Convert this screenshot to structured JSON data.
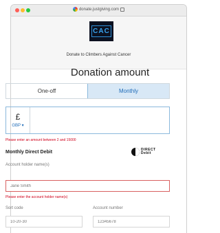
{
  "browser": {
    "url": "donate.justgiving.com"
  },
  "header": {
    "logo_text": "CAC",
    "charity_line": "Donate to Climbers Against Cancer"
  },
  "page_title": "Donation amount",
  "frequency_tabs": [
    {
      "label": "One-off",
      "selected": false
    },
    {
      "label": "Monthly",
      "selected": true
    }
  ],
  "amount": {
    "currency_symbol": "£",
    "currency_code": "GBP",
    "value": "",
    "error": "Please enter an amount between 2 and 15000"
  },
  "direct_debit": {
    "section_title": "Monthly Direct Debit",
    "logo_text": "DIRECT Debit",
    "account_holder_label": "Account holder name(s)",
    "account_holder_placeholder": "Jane Smith",
    "account_holder_error": "Please enter the account holder name(s)",
    "sort_code_label": "Sort code",
    "sort_code_placeholder": "10-20-30",
    "account_number_label": "Account number",
    "account_number_placeholder": "12345678"
  },
  "colors": {
    "accent": "#1e6bb8",
    "selected_tab_bg": "#d8e8f6",
    "error": "#d0021b",
    "logo_bg": "#0c1120",
    "logo_text": "#39a2ee"
  }
}
